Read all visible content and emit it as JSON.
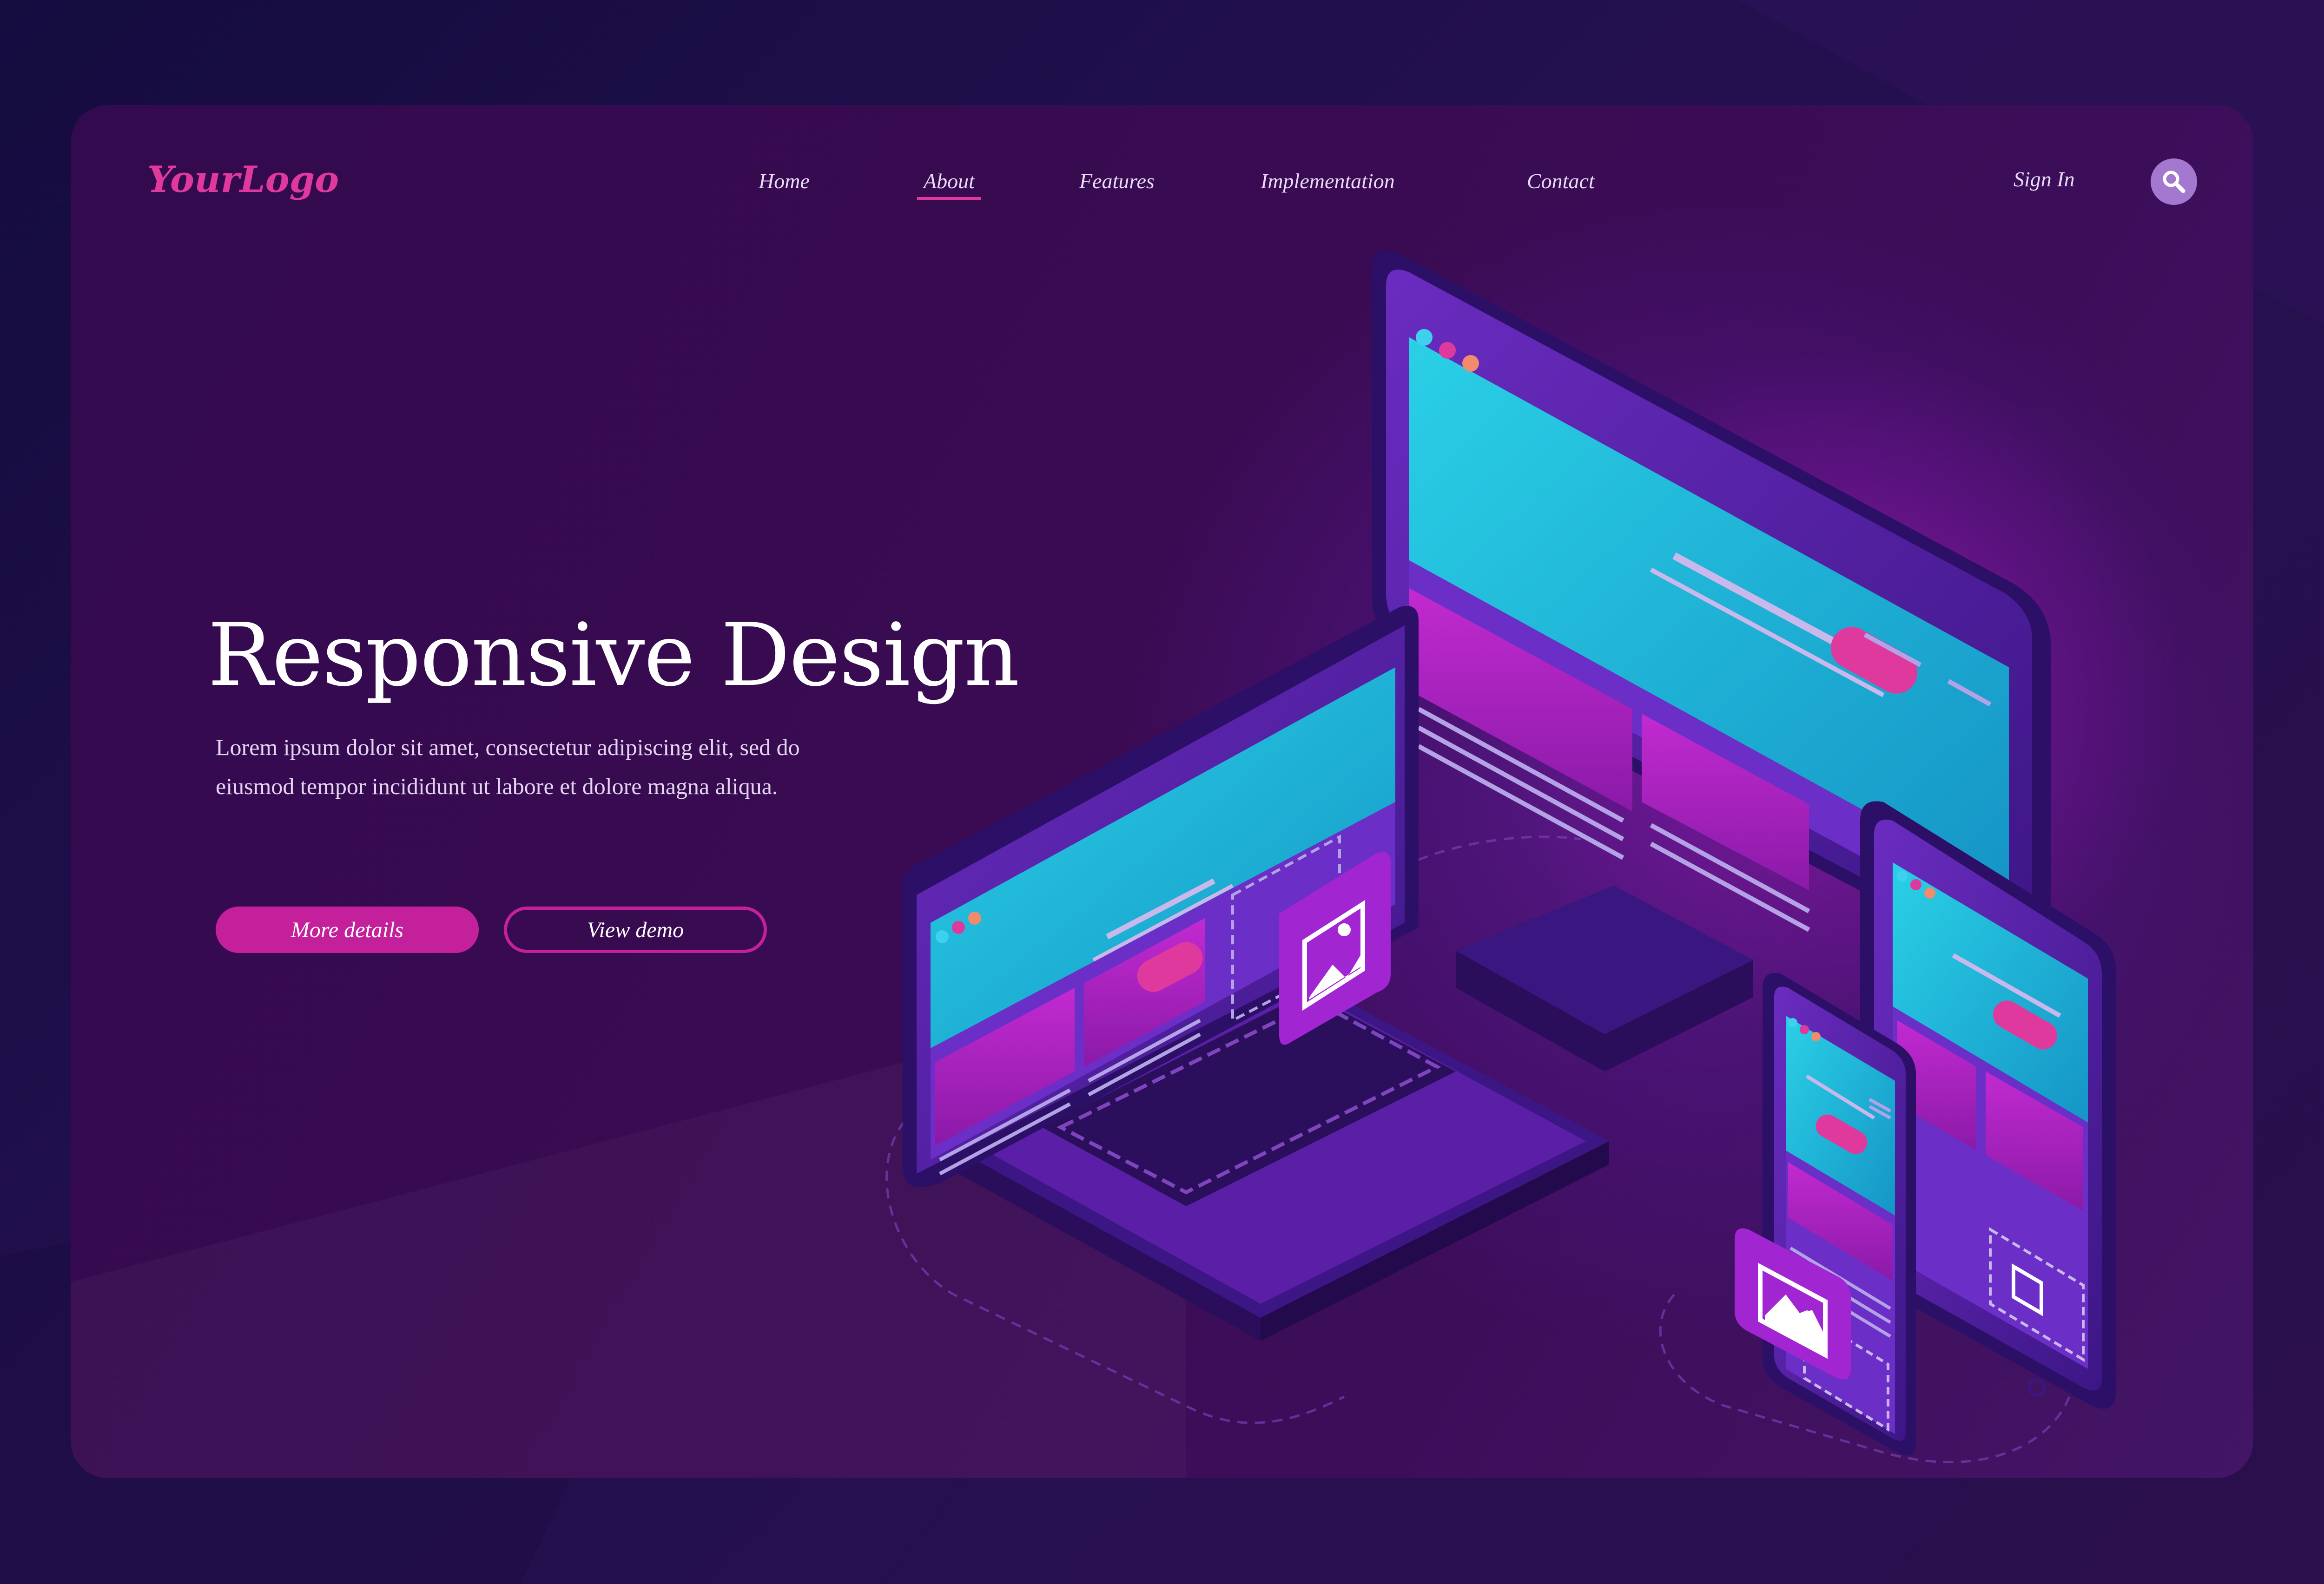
{
  "brand": {
    "logo": "YourLogo"
  },
  "nav": {
    "items": [
      {
        "label": "Home"
      },
      {
        "label": "About",
        "active": true
      },
      {
        "label": "Features"
      },
      {
        "label": "Implementation"
      },
      {
        "label": "Contact"
      }
    ],
    "sign_in": "Sign In",
    "search_icon": "search-icon"
  },
  "hero": {
    "title": "Responsive Design",
    "description": "Lorem ipsum dolor sit amet, consectetur adipiscing elit, sed do eiusmod tempor incididunt ut labore et dolore magna aliqua.",
    "primary_button": "More details",
    "secondary_button": "View demo"
  },
  "illustration": {
    "devices": [
      "desktop-monitor",
      "laptop",
      "tablet",
      "smartphone"
    ],
    "icons": [
      "image-icon"
    ]
  },
  "colors": {
    "accent": "#e0399e",
    "button": "#c4209c",
    "card_bg": "#3a0b52",
    "screen_cyan": "#22b8d8",
    "screen_magenta": "#b01ec6",
    "device_body": "#5a1fa6"
  }
}
